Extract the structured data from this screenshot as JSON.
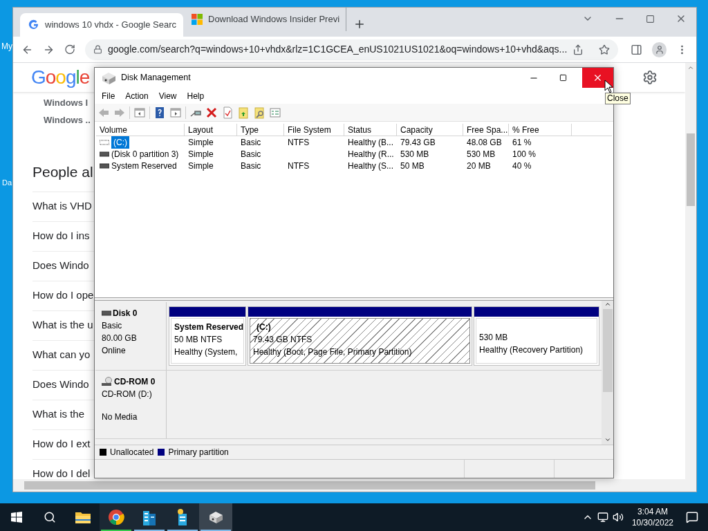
{
  "desktop": {
    "icons": [
      {
        "label": "My"
      },
      {
        "label": "Da"
      }
    ]
  },
  "browser": {
    "tabs": [
      {
        "title": "windows 10 vhdx - Google Searc",
        "selected": true
      },
      {
        "title": "Download Windows Insider Previ",
        "selected": false
      }
    ],
    "url": "google.com/search?q=windows+10+vhdx&rlz=1C1GCEA_enUS1021US1021&oq=windows+10+vhd&aqs...",
    "page": {
      "logo": "Google",
      "snippet_lines": [
        "Windows I",
        "Windows .."
      ],
      "section_heading": "People al",
      "questions": [
        "What is VHD",
        "How do I ins",
        "Does Windo",
        "How do I ope",
        "What is the u",
        "What can yo",
        "Does Windo",
        "What is the",
        "How do I ext",
        "How do I del"
      ]
    }
  },
  "disk_management": {
    "title": "Disk Management",
    "menu": [
      "File",
      "Action",
      "View",
      "Help"
    ],
    "columns": [
      "Volume",
      "Layout",
      "Type",
      "File System",
      "Status",
      "Capacity",
      "Free Spa...",
      "% Free"
    ],
    "volumes": [
      {
        "cells": [
          "(C:)",
          "Simple",
          "Basic",
          "NTFS",
          "Healthy (B...",
          "79.43 GB",
          "48.08 GB",
          "61 %"
        ],
        "selected": true
      },
      {
        "cells": [
          "(Disk 0 partition 3)",
          "Simple",
          "Basic",
          "",
          "Healthy (R...",
          "530 MB",
          "530 MB",
          "100 %"
        ],
        "selected": false
      },
      {
        "cells": [
          "System Reserved",
          "Simple",
          "Basic",
          "NTFS",
          "Healthy (S...",
          "50 MB",
          "20 MB",
          "40 %"
        ],
        "selected": false
      }
    ],
    "disks": [
      {
        "kind": "disk",
        "name": "Disk 0",
        "type": "Basic",
        "size": "80.00 GB",
        "status": "Online",
        "partitions": [
          {
            "title": "System Reserved",
            "size": "50 MB NTFS",
            "status": "Healthy (System,",
            "selected": false
          },
          {
            "title": "(C:)",
            "size": "79.43 GB NTFS",
            "status": "Healthy (Boot, Page File, Primary Partition)",
            "selected": true
          },
          {
            "size": "530 MB",
            "status": "Healthy (Recovery Partition)",
            "selected": false
          }
        ]
      },
      {
        "kind": "cdrom",
        "name": "CD-ROM 0",
        "type": "CD-ROM (D:)",
        "status": "No Media"
      }
    ],
    "legend": [
      {
        "label": "Unallocated",
        "color": "#000000"
      },
      {
        "label": "Primary partition",
        "color": "#000080"
      }
    ],
    "tooltip": "Close"
  },
  "taskbar": {
    "apps": [
      {
        "kind": "folder",
        "running": false,
        "selected": false
      },
      {
        "kind": "chrome",
        "running": true,
        "selected": false,
        "color": "#35c94c"
      },
      {
        "kind": "building",
        "running": true,
        "selected": false,
        "color": "#7fb8e6"
      },
      {
        "kind": "building-star",
        "running": true,
        "selected": false,
        "color": "#7fb8e6"
      },
      {
        "kind": "disk",
        "running": true,
        "selected": true,
        "color": "#7fb8e6"
      }
    ],
    "time": "3:04 AM",
    "date": "10/30/2022"
  }
}
